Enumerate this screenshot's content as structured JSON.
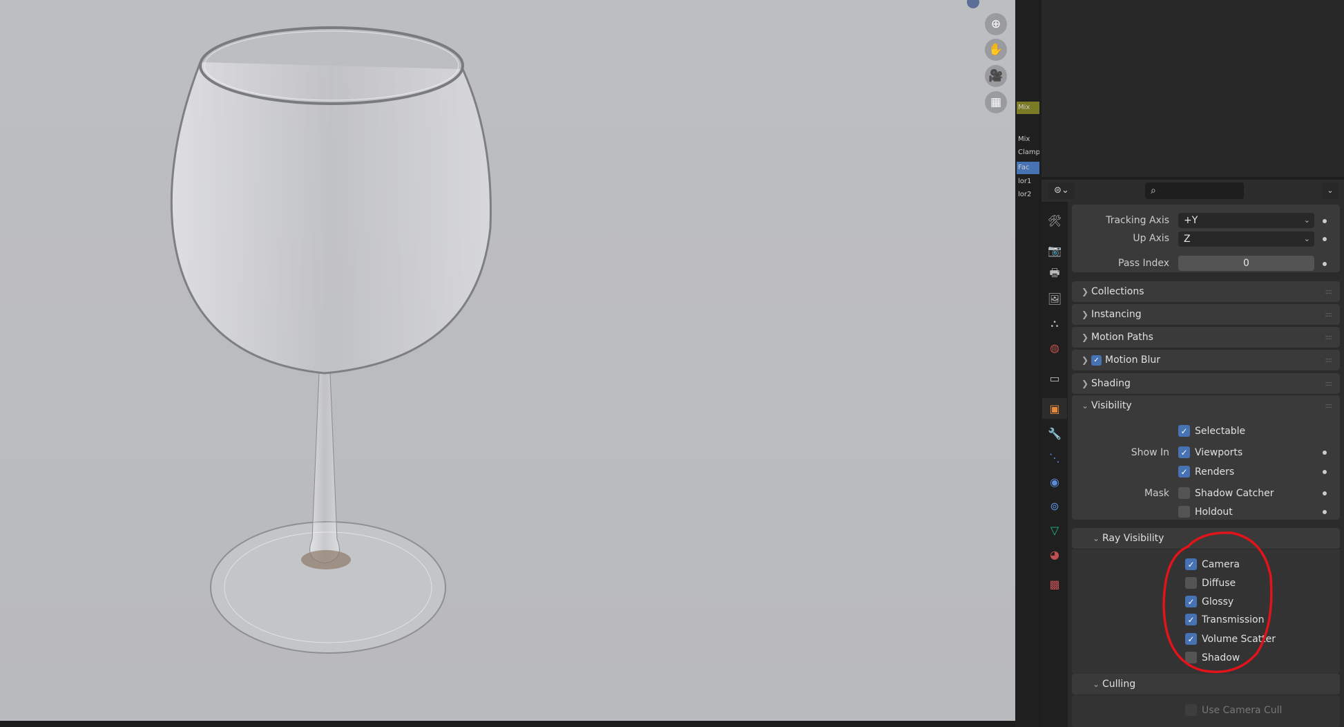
{
  "viewport": {
    "gizmos": [
      "zoom-icon",
      "hand-pan-icon",
      "camera-icon",
      "grid-ortho-icon"
    ]
  },
  "node_strip": {
    "sockets": [
      "Mix",
      "Mix",
      "Clamp",
      "Fac",
      "lor1",
      "lor2"
    ]
  },
  "properties": {
    "search_placeholder": "",
    "tracking_axis": {
      "label": "Tracking Axis",
      "value": "+Y"
    },
    "up_axis": {
      "label": "Up Axis",
      "value": "Z"
    },
    "pass_index": {
      "label": "Pass Index",
      "value": "0"
    },
    "panels": {
      "collections": "Collections",
      "instancing": "Instancing",
      "motion_paths": "Motion Paths",
      "motion_blur": "Motion Blur",
      "shading": "Shading",
      "visibility": "Visibility",
      "ray_visibility": "Ray Visibility",
      "culling": "Culling"
    },
    "motion_blur_enabled": true,
    "visibility": {
      "selectable": {
        "label": "Selectable",
        "checked": true
      },
      "show_in_label": "Show In",
      "viewports": {
        "label": "Viewports",
        "checked": true
      },
      "renders": {
        "label": "Renders",
        "checked": true
      },
      "mask_label": "Mask",
      "shadow_catcher": {
        "label": "Shadow Catcher",
        "checked": false
      },
      "holdout": {
        "label": "Holdout",
        "checked": false
      }
    },
    "ray_visibility": [
      {
        "label": "Camera",
        "checked": true
      },
      {
        "label": "Diffuse",
        "checked": false
      },
      {
        "label": "Glossy",
        "checked": true
      },
      {
        "label": "Transmission",
        "checked": true
      },
      {
        "label": "Volume Scatter",
        "checked": true
      },
      {
        "label": "Shadow",
        "checked": false
      }
    ],
    "culling": {
      "use_camera_cull": {
        "label": "Use Camera Cull",
        "checked": false
      }
    }
  },
  "colors": {
    "accent": "#4772b3",
    "annotation": "#e0141a",
    "active_tab": "#e8893a"
  }
}
